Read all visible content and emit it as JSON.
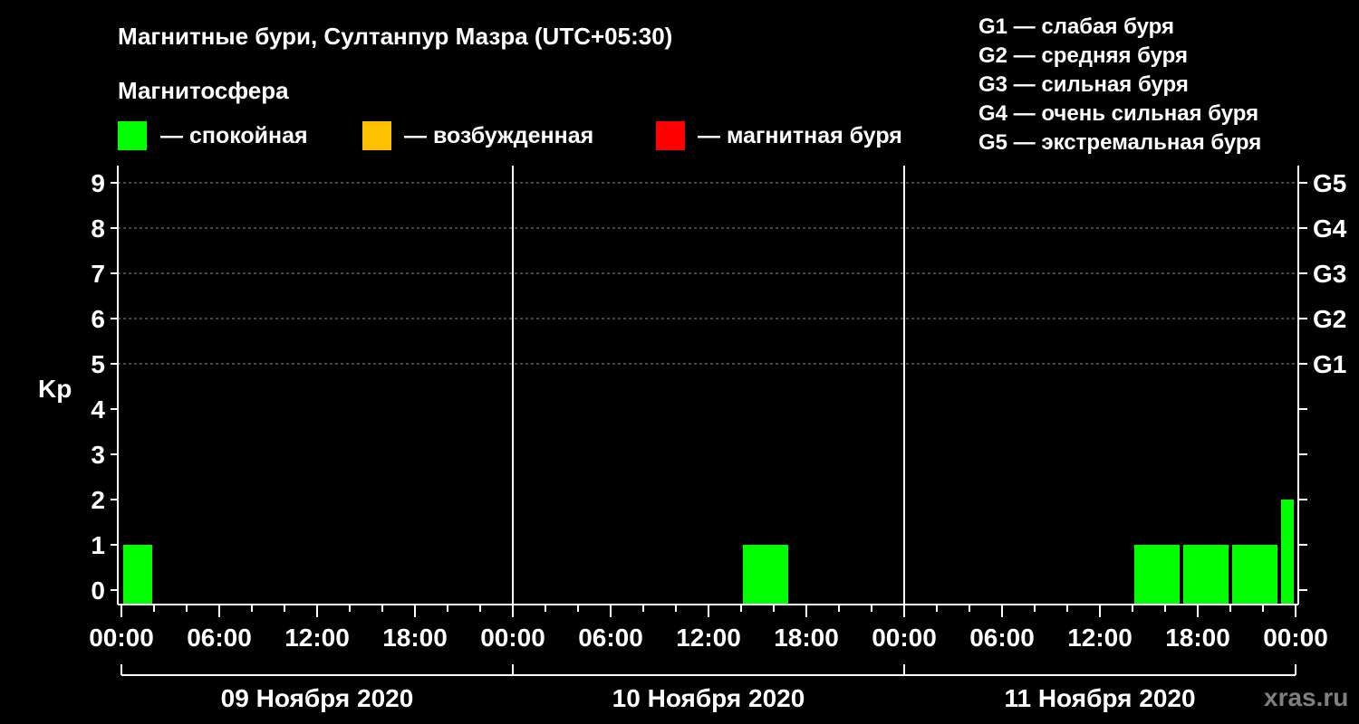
{
  "title": "Магнитные бури, Султанпур Мазра (UTC+05:30)",
  "legend": {
    "heading": "Магнитосфера",
    "items": [
      {
        "label": "— спокойная",
        "color": "#00ff00"
      },
      {
        "label": "— возбужденная",
        "color": "#ffc000"
      },
      {
        "label": "— магнитная буря",
        "color": "#ff0000"
      }
    ],
    "g_scale": [
      "G1 — слабая буря",
      "G2 — средняя буря",
      "G3 — сильная буря",
      "G4 — очень сильная буря",
      "G5 — экстремальная буря"
    ]
  },
  "watermark": "xras.ru",
  "chart_data": {
    "type": "bar",
    "ylabel": "Kp",
    "ylim": [
      0,
      9
    ],
    "yticks": [
      "0",
      "1",
      "2",
      "3",
      "4",
      "5",
      "6",
      "7",
      "8",
      "9"
    ],
    "right_ticks": [
      {
        "kp": 5,
        "label": "G1"
      },
      {
        "kp": 6,
        "label": "G2"
      },
      {
        "kp": 7,
        "label": "G3"
      },
      {
        "kp": 8,
        "label": "G4"
      },
      {
        "kp": 9,
        "label": "G5"
      }
    ],
    "grid": "dashed horizontal at Kp 5–9",
    "x_range_hours": [
      0,
      72
    ],
    "x_tick_labels": [
      "00:00",
      "06:00",
      "12:00",
      "18:00",
      "00:00",
      "06:00",
      "12:00",
      "18:00",
      "00:00",
      "06:00",
      "12:00",
      "18:00",
      "00:00"
    ],
    "days": [
      "09 Ноября 2020",
      "10 Ноября 2020",
      "11 Ноября 2020"
    ],
    "bars": [
      {
        "start_hour": 0,
        "end_hour": 2,
        "kp": 1,
        "status": "calm"
      },
      {
        "start_hour": 38,
        "end_hour": 41,
        "kp": 1,
        "status": "calm"
      },
      {
        "start_hour": 62,
        "end_hour": 65,
        "kp": 1,
        "status": "calm"
      },
      {
        "start_hour": 65,
        "end_hour": 68,
        "kp": 1,
        "status": "calm"
      },
      {
        "start_hour": 68,
        "end_hour": 71,
        "kp": 1,
        "status": "calm"
      },
      {
        "start_hour": 71,
        "end_hour": 72,
        "kp": 2,
        "status": "calm"
      }
    ],
    "status_colors": {
      "calm": "#00ff00",
      "active": "#ffc000",
      "storm": "#ff0000"
    }
  }
}
